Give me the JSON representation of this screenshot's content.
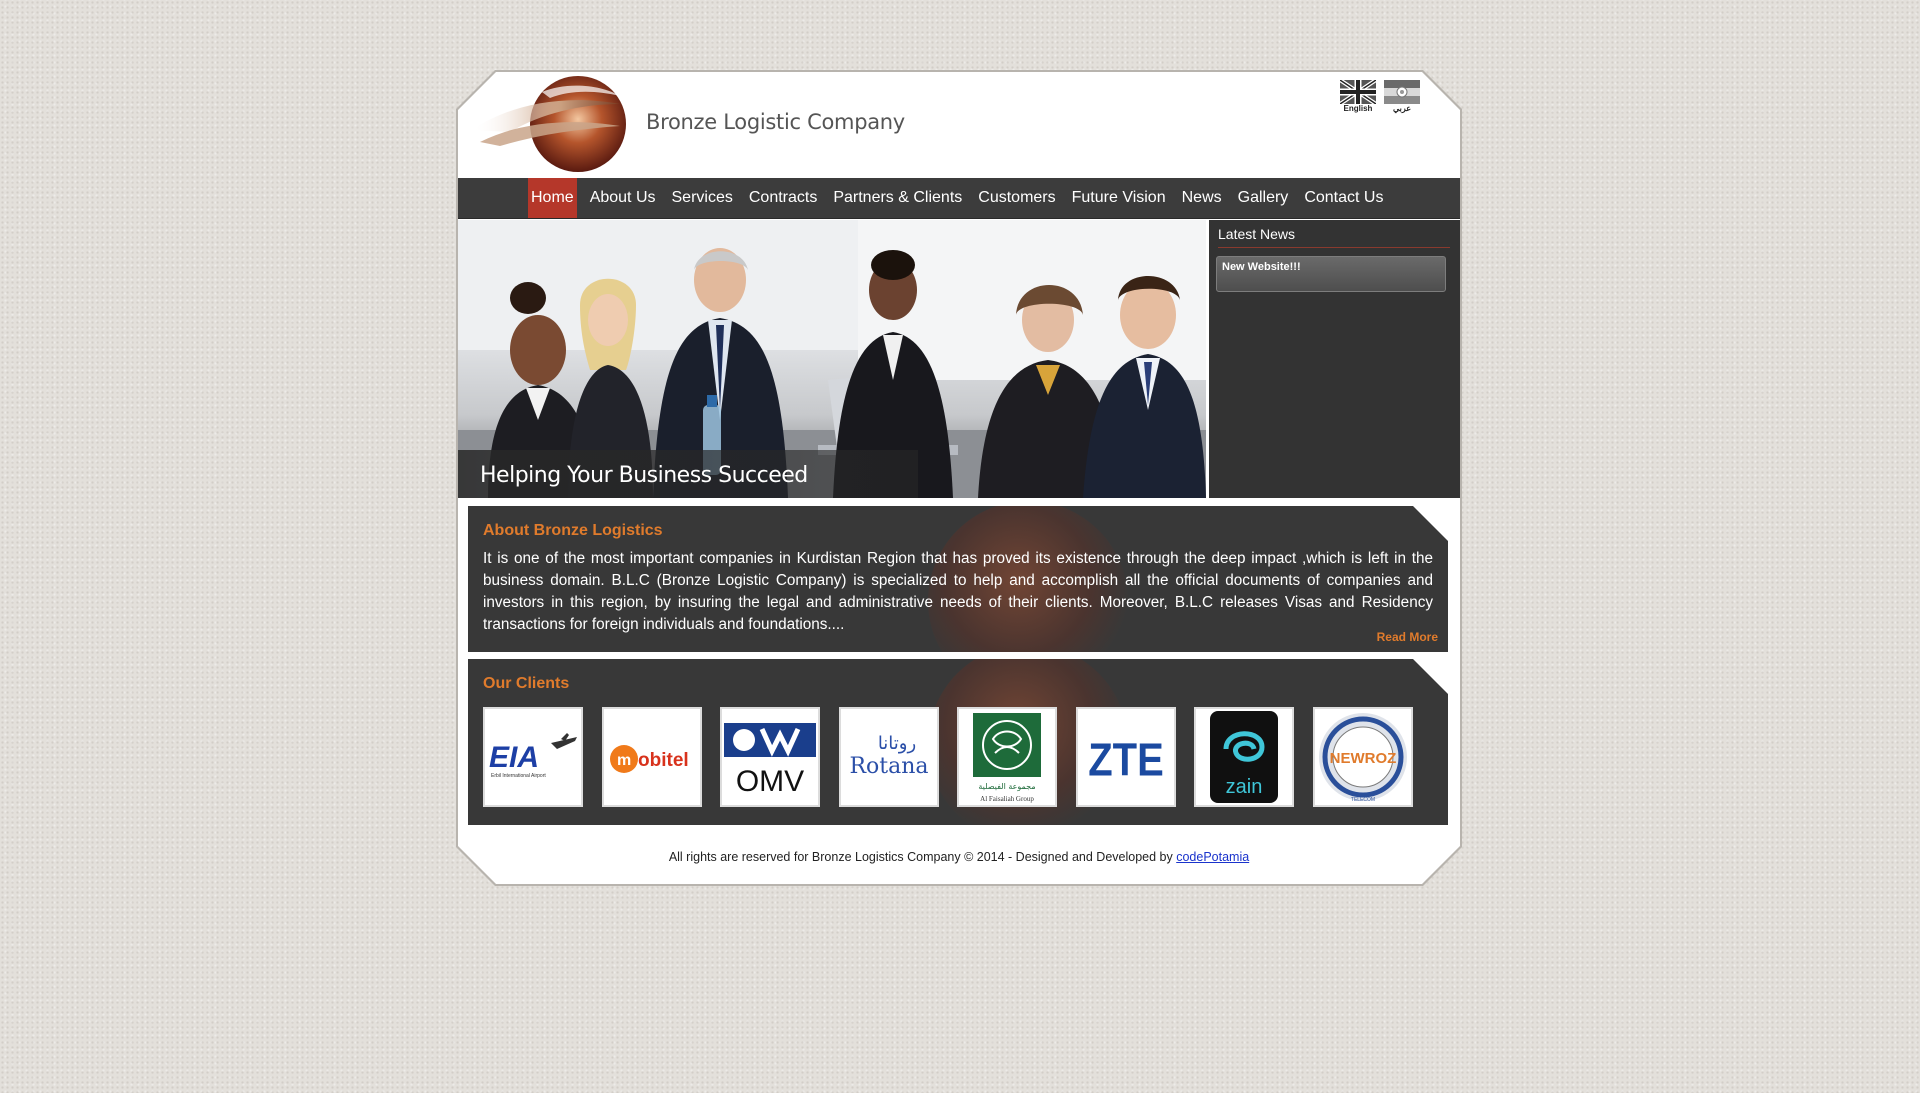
{
  "header": {
    "brand_name": "Bronze Logistic Company",
    "languages": [
      {
        "label": "English",
        "code": "en"
      },
      {
        "label": "عربي",
        "code": "ar"
      }
    ]
  },
  "nav": {
    "items": [
      "Home",
      "About Us",
      "Services",
      "Contracts",
      "Partners & Clients",
      "Customers",
      "Future Vision",
      "News",
      "Gallery",
      "Contact Us"
    ],
    "active": "Home"
  },
  "banner": {
    "caption": "Helping Your Business Succeed"
  },
  "latest_news": {
    "title": "Latest News",
    "items": [
      "New Website!!!"
    ]
  },
  "about": {
    "title": "About Bronze Logistics",
    "text": "It is one of the most important companies in Kurdistan Region that has proved its existence through the deep impact ,which is left in the business domain. B.L.C (Bronze Logistic Company) is specialized to help and accomplish all the official documents of companies and investors in this region, by insuring the legal and administrative needs of their clients. Moreover, B.L.C releases Visas and Residency transactions for foreign individuals and foundations....",
    "read_more": "Read More"
  },
  "clients": {
    "title": "Our Clients",
    "logos": [
      {
        "name": "EIA",
        "subtitle": "Erbil International Airport"
      },
      {
        "name": "mobitel"
      },
      {
        "name": "OMV"
      },
      {
        "name": "Rotana",
        "arabic": "روتانا"
      },
      {
        "name": "Al Faisaliah Group",
        "arabic": "مجموعة الفيصلية"
      },
      {
        "name": "ZTE"
      },
      {
        "name": "zain"
      },
      {
        "name": "NEWROZ",
        "subtitle": "TELECOM"
      }
    ]
  },
  "footer": {
    "text": "All rights are reserved for Bronze Logistics Company © 2014 - Designed and Developed by",
    "link": "codePotamia"
  },
  "colors": {
    "accent_orange": "#e07b2c",
    "nav_active": "#b5372a",
    "dark_panel": "#383838"
  }
}
